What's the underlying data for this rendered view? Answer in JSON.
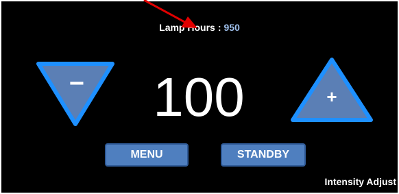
{
  "header": {
    "lamp_hours_label": "Lamp Hours",
    "separator": ":",
    "lamp_hours_value": "950"
  },
  "controls": {
    "decrease_symbol": "−",
    "increase_symbol": "+",
    "intensity_value": "100"
  },
  "buttons": {
    "menu_label": "MENU",
    "standby_label": "STANDBY"
  },
  "footer": {
    "mode_label": "Intensity Adjust"
  },
  "colors": {
    "background": "#000000",
    "triangle_fill": "#5b7fb5",
    "triangle_border": "#1e90ff",
    "button_fill": "#4f7fbf",
    "lamp_value_color": "#9fc0ec",
    "arrow_annotation": "#e00000"
  },
  "icons": {
    "decrease": "down-triangle-minus-icon",
    "increase": "up-triangle-plus-icon",
    "annotation": "red-arrow-icon"
  }
}
